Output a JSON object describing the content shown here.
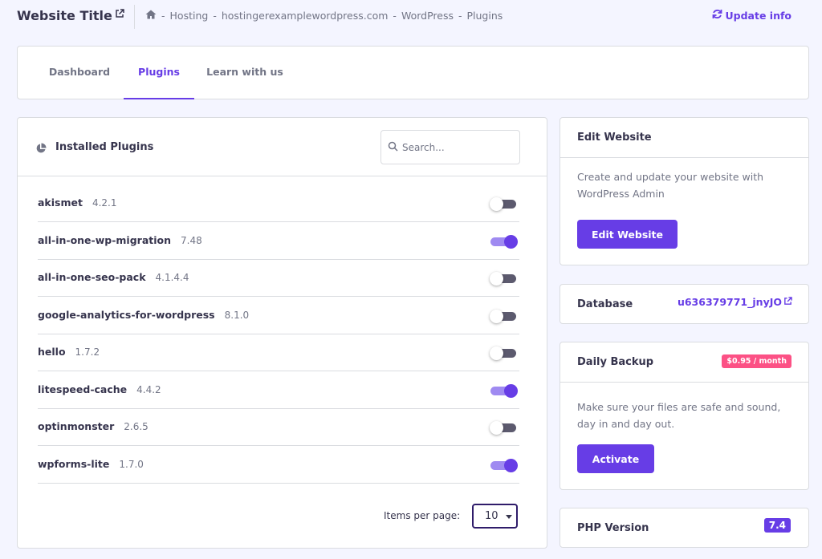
{
  "header": {
    "site_title": "Website Title",
    "breadcrumb": [
      "Hosting",
      "hostingerexamplewordpress.com",
      "WordPress",
      "Plugins"
    ],
    "breadcrumb_sep": "-",
    "update_info": "Update info"
  },
  "tabs": [
    {
      "label": "Dashboard",
      "active": false
    },
    {
      "label": "Plugins",
      "active": true
    },
    {
      "label": "Learn with us",
      "active": false
    }
  ],
  "plugins": {
    "title": "Installed Plugins",
    "search_placeholder": "Search...",
    "items": [
      {
        "name": "akismet",
        "version": "4.2.1",
        "enabled": false
      },
      {
        "name": "all-in-one-wp-migration",
        "version": "7.48",
        "enabled": true
      },
      {
        "name": "all-in-one-seo-pack",
        "version": "4.1.4.4",
        "enabled": false
      },
      {
        "name": "google-analytics-for-wordpress",
        "version": "8.1.0",
        "enabled": false
      },
      {
        "name": "hello",
        "version": "1.7.2",
        "enabled": false
      },
      {
        "name": "litespeed-cache",
        "version": "4.4.2",
        "enabled": true
      },
      {
        "name": "optinmonster",
        "version": "2.6.5",
        "enabled": false
      },
      {
        "name": "wpforms-lite",
        "version": "1.7.0",
        "enabled": true
      }
    ],
    "items_per_page_label": "Items per page:",
    "items_per_page_value": "10"
  },
  "edit_website": {
    "title": "Edit Website",
    "description": "Create and update your website with WordPress Admin",
    "button_label": "Edit Website"
  },
  "database": {
    "label": "Database",
    "value": "u636379771_jnyJO"
  },
  "daily_backup": {
    "title": "Daily Backup",
    "price_badge": "$0.95 / month",
    "description": "Make sure your files are safe and sound, day in and day out.",
    "button_label": "Activate"
  },
  "php": {
    "label": "PHP Version",
    "value": "7.4"
  },
  "colors": {
    "accent": "#673de6",
    "price_badge": "#fc5185",
    "background": "#f4f5ff"
  }
}
